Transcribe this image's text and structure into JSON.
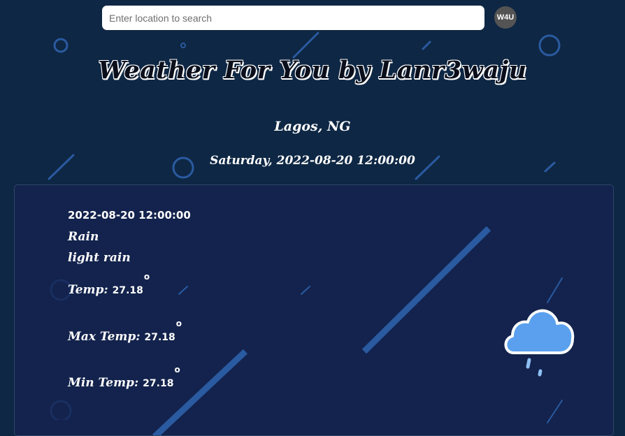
{
  "search": {
    "placeholder": "Enter location to search",
    "value": ""
  },
  "brand": {
    "avatar_text": "W4U"
  },
  "page": {
    "title": "Weather For You by Lanr3waju",
    "location": "Lagos, NG",
    "datetime": "Saturday, 2022-08-20 12:00:00"
  },
  "forecast": {
    "date": "2022-08-20 12:00:00",
    "main": "Rain",
    "description": "light rain",
    "degree_symbol": "o",
    "temp": {
      "label": "Temp:",
      "value": "27.18"
    },
    "max_temp": {
      "label": "Max Temp:",
      "value": "27.18"
    },
    "min_temp": {
      "label": "Min Temp:",
      "value": "27.18"
    },
    "icon": "rain-cloud-icon"
  },
  "colors": {
    "background": "#0e2744",
    "card": "#142350",
    "decoration": "#2a5aa0",
    "cloud": "#5aa0ee",
    "avatar": "#545454"
  }
}
